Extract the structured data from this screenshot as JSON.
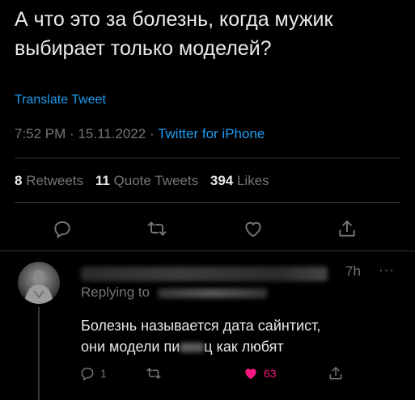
{
  "tweet": {
    "text": "А что это за болезнь, когда мужик выбирает только моделей?",
    "translate_label": "Translate Tweet",
    "time": "7:52 PM",
    "date": "15.11.2022",
    "source": "Twitter for iPhone"
  },
  "stats": {
    "retweets_count": "8",
    "retweets_label": "Retweets",
    "quotes_count": "11",
    "quotes_label": "Quote Tweets",
    "likes_count": "394",
    "likes_label": "Likes"
  },
  "actions": [
    "reply-icon",
    "retweet-icon",
    "like-icon",
    "share-icon"
  ],
  "reply": {
    "time": "7h",
    "more": "···",
    "replying_to_label": "Replying to",
    "text_line1": "Болезнь называется дата сайнтист,",
    "text_line2_a": "они модели пи",
    "text_line2_b": "ц как любят",
    "reply_count": "1",
    "like_count": "63"
  },
  "colors": {
    "background": "#000000",
    "text": "#e7e9ea",
    "secondary": "#71767b",
    "accent": "#1d9bf0",
    "like": "#f91880",
    "divider": "#2f3336"
  }
}
